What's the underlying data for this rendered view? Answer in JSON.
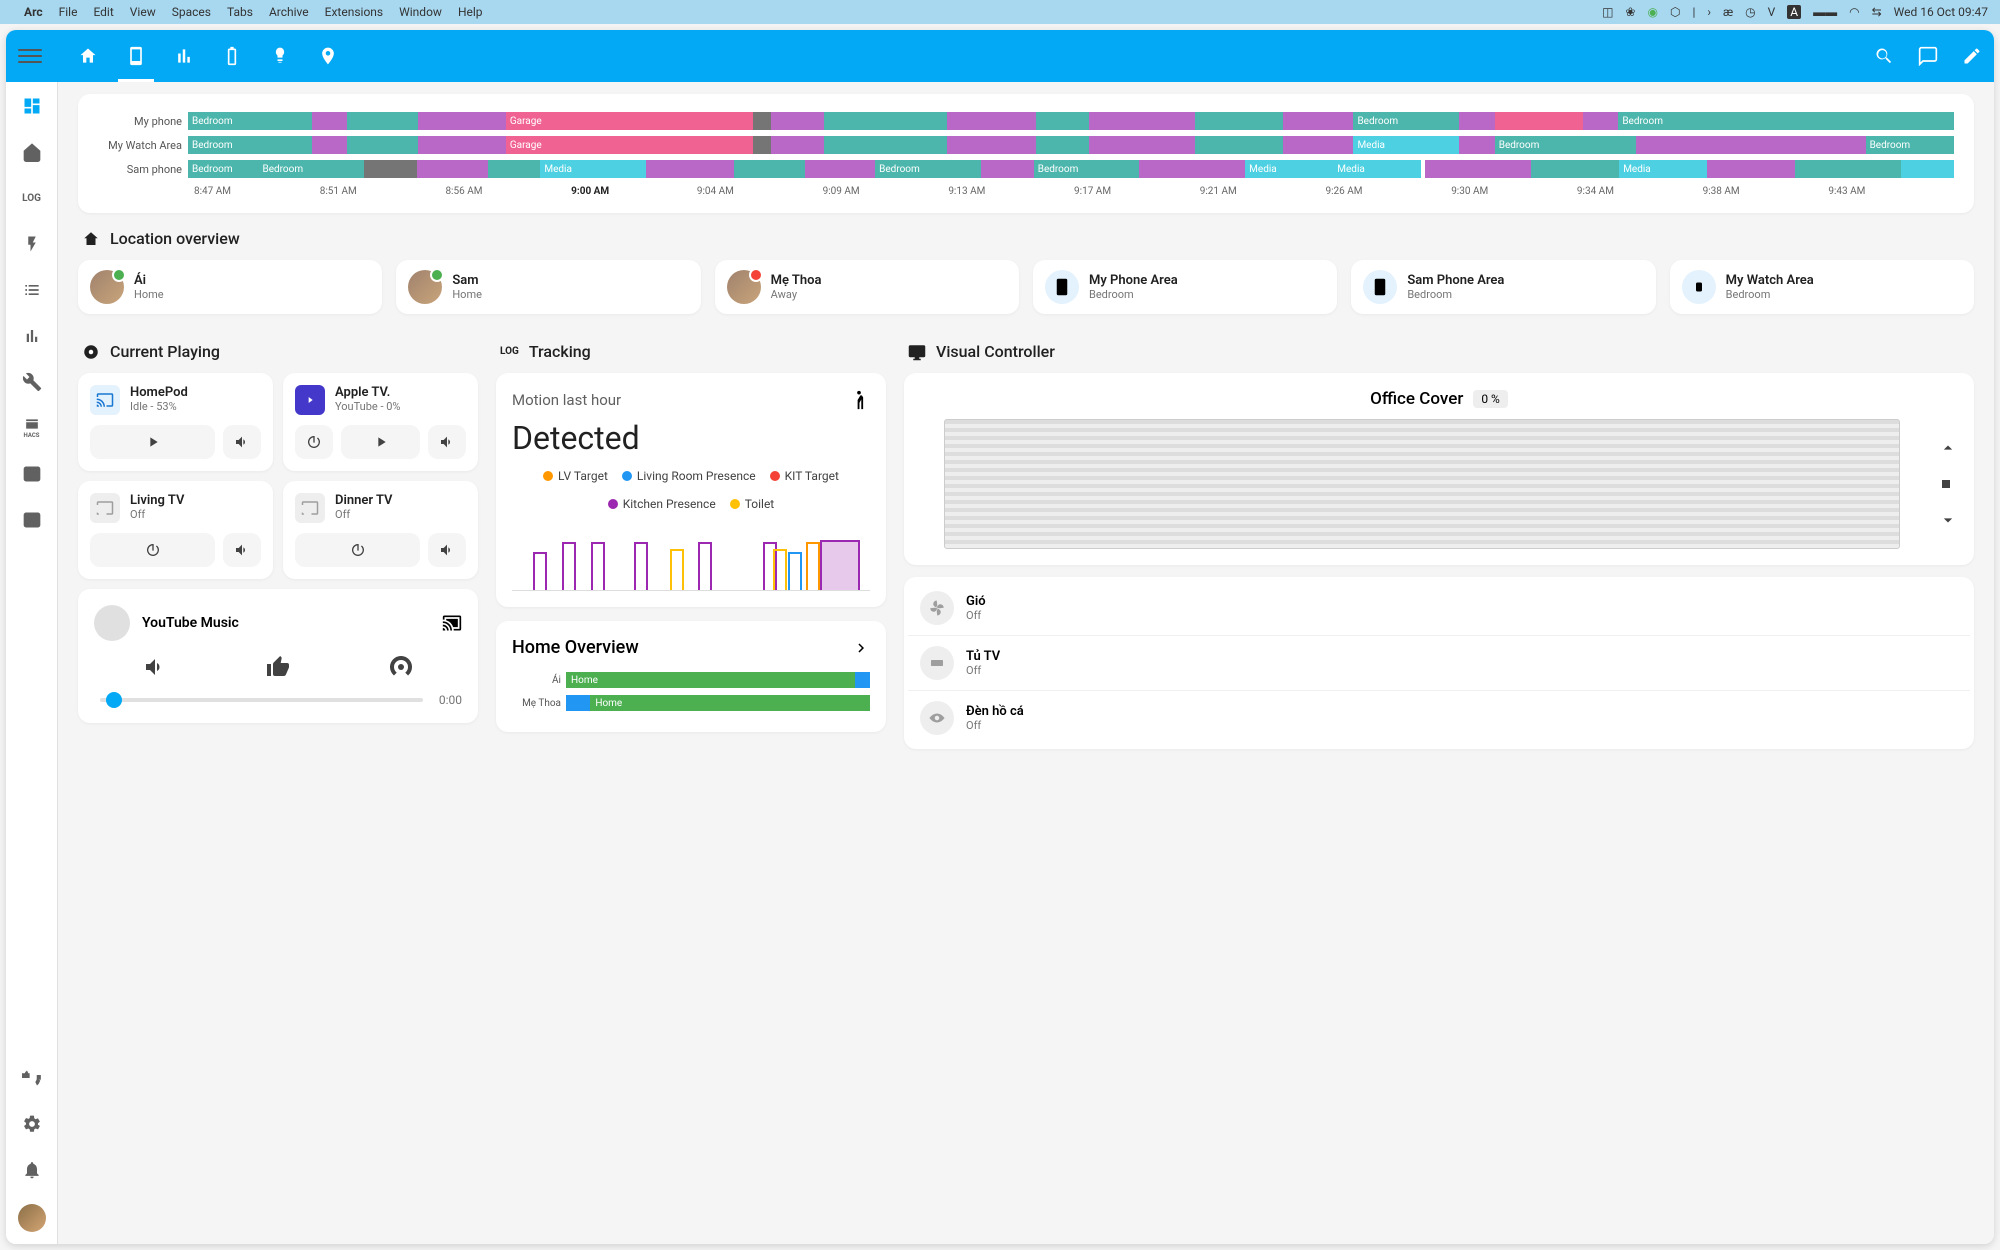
{
  "macos": {
    "app": "Arc",
    "menus": [
      "File",
      "Edit",
      "View",
      "Spaces",
      "Tabs",
      "Archive",
      "Extensions",
      "Window",
      "Help"
    ],
    "clock": "Wed 16 Oct  09:47"
  },
  "sections": {
    "location": "Location overview",
    "playing": "Current Playing",
    "tracking": "Tracking",
    "visual": "Visual Controller"
  },
  "timeline": {
    "rows": [
      {
        "label": "My phone"
      },
      {
        "label": "My Watch Area"
      },
      {
        "label": "Sam phone"
      }
    ],
    "segs": {
      "bedroom": "Bedroom",
      "garage": "Garage",
      "media": "Media"
    },
    "ticks": [
      "8:47 AM",
      "8:51 AM",
      "8:56 AM",
      "9:00 AM",
      "9:04 AM",
      "9:09 AM",
      "9:13 AM",
      "9:17 AM",
      "9:21 AM",
      "9:26 AM",
      "9:30 AM",
      "9:34 AM",
      "9:38 AM",
      "9:43 AM"
    ]
  },
  "locations": [
    {
      "name": "Ái",
      "status": "Home",
      "type": "person",
      "badge": "home"
    },
    {
      "name": "Sam",
      "status": "Home",
      "type": "person",
      "badge": "home"
    },
    {
      "name": "Mẹ Thoa",
      "status": "Away",
      "type": "person",
      "badge": "away"
    },
    {
      "name": "My Phone Area",
      "status": "Bedroom",
      "type": "device",
      "icon": "phone"
    },
    {
      "name": "Sam Phone Area",
      "status": "Bedroom",
      "type": "device",
      "icon": "phone"
    },
    {
      "name": "My Watch Area",
      "status": "Bedroom",
      "type": "device",
      "icon": "watch"
    }
  ],
  "media": [
    {
      "name": "HomePod",
      "sub": "Idle - 53%",
      "icon": "cast",
      "ctrls": [
        "play",
        "vol"
      ]
    },
    {
      "name": "Apple TV.",
      "sub": "YouTube - 0%",
      "icon": "yt",
      "ctrls": [
        "power",
        "play",
        "vol"
      ]
    },
    {
      "name": "Living TV",
      "sub": "Off",
      "icon": "off",
      "ctrls": [
        "power",
        "vol"
      ]
    },
    {
      "name": "Dinner TV",
      "sub": "Off",
      "icon": "off",
      "ctrls": [
        "power",
        "vol"
      ]
    }
  ],
  "ytmusic": {
    "title": "YouTube Music",
    "time": "0:00"
  },
  "tracking": {
    "title": "Motion last hour",
    "value": "Detected",
    "legend": [
      {
        "label": "LV Target",
        "color": "#ff9800"
      },
      {
        "label": "Living Room Presence",
        "color": "#2196f3"
      },
      {
        "label": "KIT Target",
        "color": "#f44336"
      },
      {
        "label": "Kitchen Presence",
        "color": "#9c27b0"
      },
      {
        "label": "Toilet",
        "color": "#ffc107"
      }
    ]
  },
  "overview": {
    "title": "Home Overview",
    "rows": [
      {
        "label": "Ái",
        "seg": "Home",
        "color": "#4caf50"
      },
      {
        "label": "Mẹ Thoa",
        "seg": "Home",
        "color": "#4caf50"
      }
    ]
  },
  "visual": {
    "title": "Office Cover",
    "pct": "0 %"
  },
  "entities": [
    {
      "name": "Gió",
      "state": "Off"
    },
    {
      "name": "Tủ TV",
      "state": "Off"
    },
    {
      "name": "Đèn hồ cá",
      "state": "Off"
    }
  ]
}
